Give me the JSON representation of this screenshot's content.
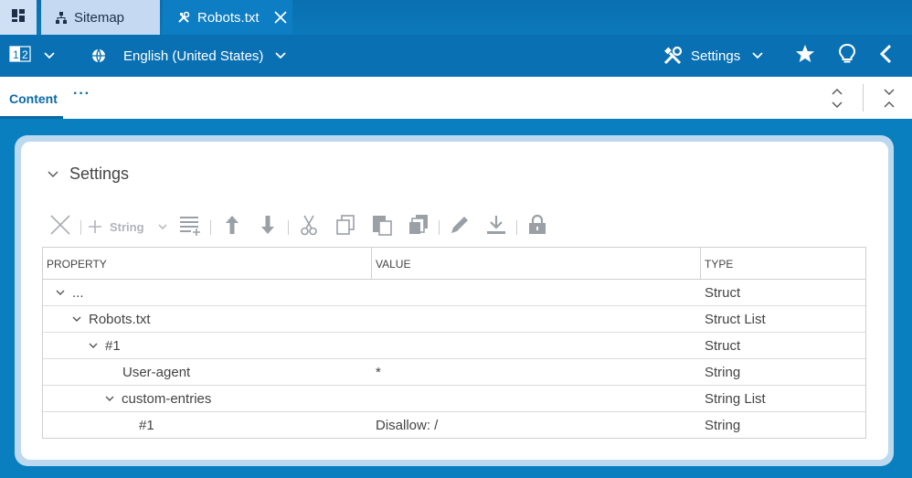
{
  "tabs": [
    {
      "label": "Sitemap",
      "icon": "sitemap-icon"
    },
    {
      "label": "Robots.txt",
      "icon": "tools-icon",
      "active": true
    }
  ],
  "toolbar": {
    "language": "English (United States)",
    "settings_label": "Settings",
    "icons": [
      "numbers-icon",
      "chevron-down-icon",
      "globe-icon",
      "settings-tools-icon",
      "star-icon",
      "lightbulb-icon",
      "back-arrow-icon"
    ]
  },
  "subbar": {
    "content_tab": "Content",
    "more": "···"
  },
  "section": {
    "title": "Settings"
  },
  "actions": {
    "add_type": "String",
    "icons": [
      "delete-icon",
      "add-icon",
      "type-dropdown-icon",
      "add-rows-icon",
      "move-up-icon",
      "move-down-icon",
      "cut-icon",
      "copy-icon",
      "paste-icon",
      "paste-multi-icon",
      "edit-icon",
      "download-icon",
      "lock-icon"
    ]
  },
  "table": {
    "columns": [
      "PROPERTY",
      "VALUE",
      "TYPE"
    ],
    "rows": [
      {
        "property": "...",
        "value": "",
        "type": "Struct",
        "depth": 0,
        "expanded": true
      },
      {
        "property": "Robots.txt",
        "value": "",
        "type": "Struct List",
        "depth": 1,
        "expanded": true
      },
      {
        "property": "#1",
        "value": "",
        "type": "Struct",
        "depth": 2,
        "expanded": true
      },
      {
        "property": "User-agent",
        "value": "*",
        "type": "String",
        "depth": 3,
        "expanded": false
      },
      {
        "property": "custom-entries",
        "value": "",
        "type": "String List",
        "depth": 3,
        "expanded": true
      },
      {
        "property": "#1",
        "value": "Disallow: /",
        "type": "String",
        "depth": 4,
        "expanded": false
      }
    ]
  },
  "colors": {
    "brand_blue": "#0a70b4",
    "accent_link": "#0a6aa6",
    "inactive_tab": "#c6d9f2"
  }
}
